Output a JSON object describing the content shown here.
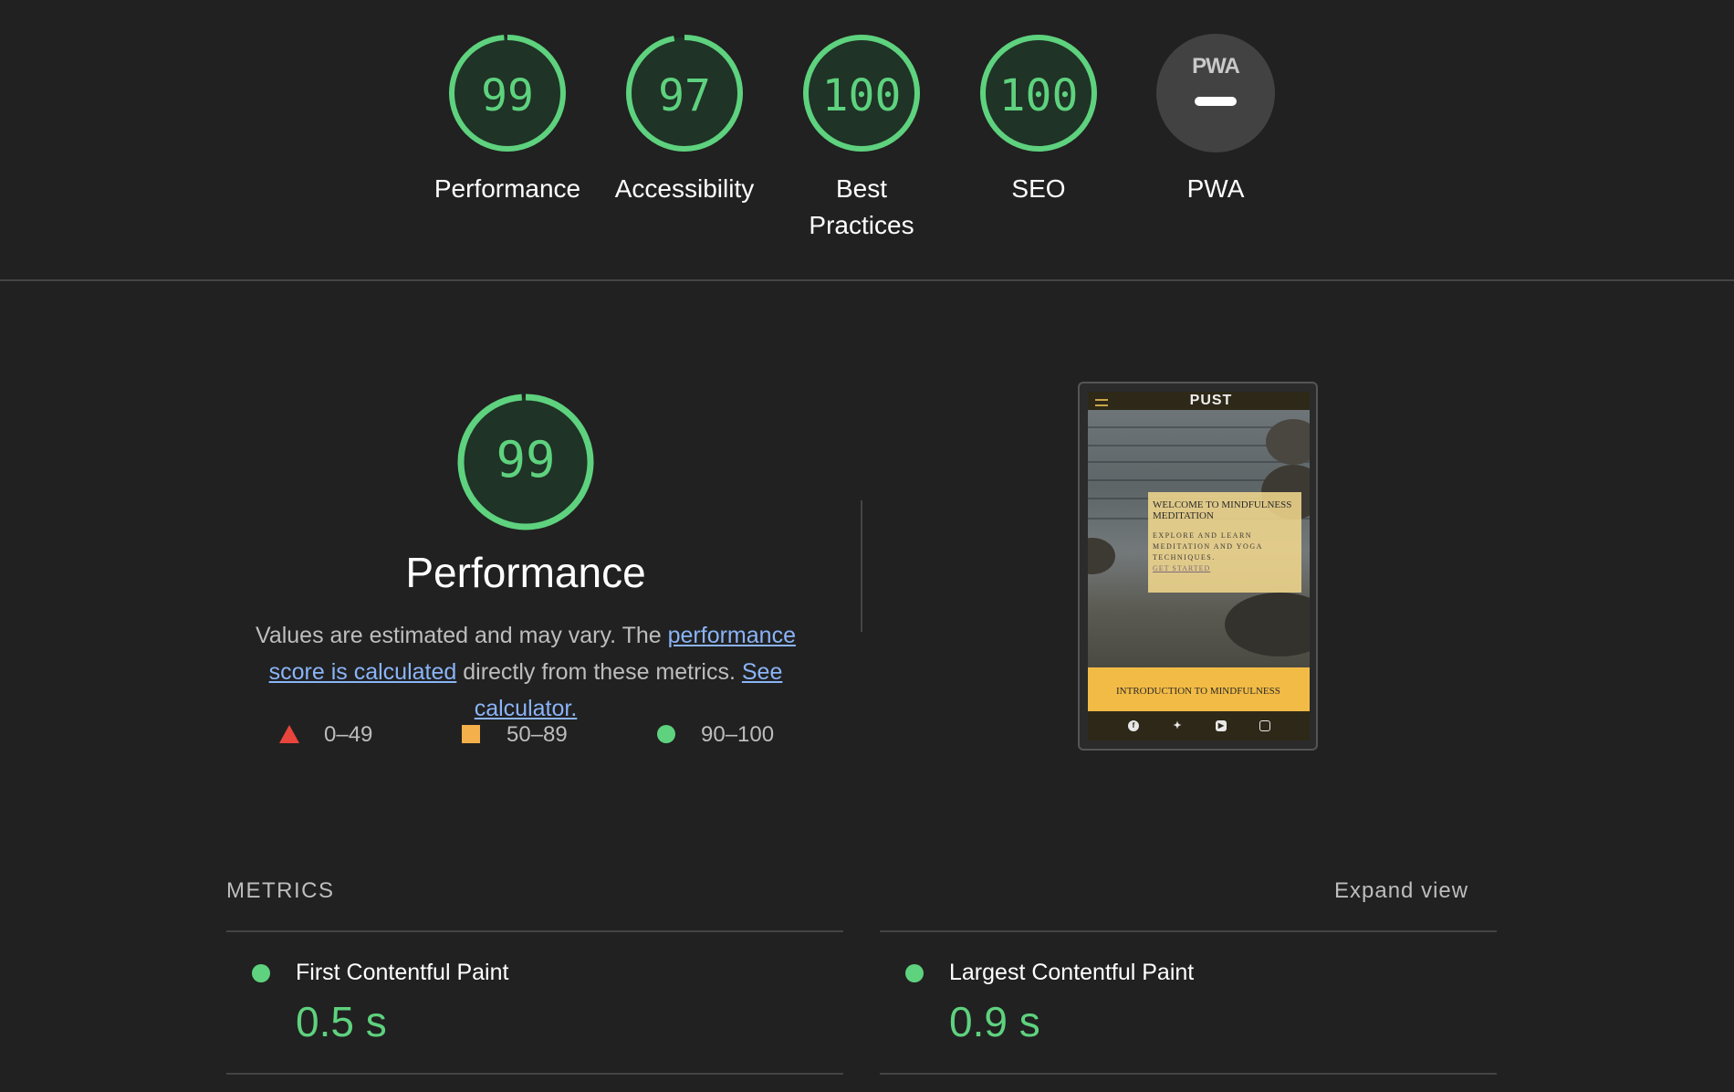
{
  "colors": {
    "background": "#212121",
    "pass": "#5ed27e",
    "average": "#f4b04a",
    "fail": "#e8453c",
    "link": "#8ab4f8"
  },
  "categories": [
    {
      "label": "Performance",
      "score": 99
    },
    {
      "label": "Accessibility",
      "score": 97
    },
    {
      "label": "Best Practices",
      "score": 100
    },
    {
      "label": "SEO",
      "score": 100
    },
    {
      "label": "PWA",
      "badge_text": "PWA"
    }
  ],
  "performance": {
    "score": 99,
    "title": "Performance",
    "desc_before": "Values are estimated and may vary. The ",
    "link1": "performance score is calculated",
    "desc_middle": " directly from these metrics. ",
    "link2": "See calculator."
  },
  "legend": {
    "fail": "0–49",
    "average": "50–89",
    "pass": "90–100"
  },
  "screenshot": {
    "brand": "PUST",
    "hero_title": "WELCOME TO MINDFULNESS MEDITATION",
    "hero_text": "EXPLORE AND LEARN MEDITATION AND YOGA TECHNIQUES.",
    "hero_link": "GET STARTED",
    "section_title": "INTRODUCTION TO MINDFULNESS",
    "social_icons": [
      "facebook-icon",
      "twitter-icon",
      "youtube-icon",
      "instagram-icon"
    ]
  },
  "metrics": {
    "title": "METRICS",
    "expand_label": "Expand view",
    "items": [
      {
        "label": "First Contentful Paint",
        "value": "0.5 s"
      },
      {
        "label": "Largest Contentful Paint",
        "value": "0.9 s"
      }
    ]
  }
}
